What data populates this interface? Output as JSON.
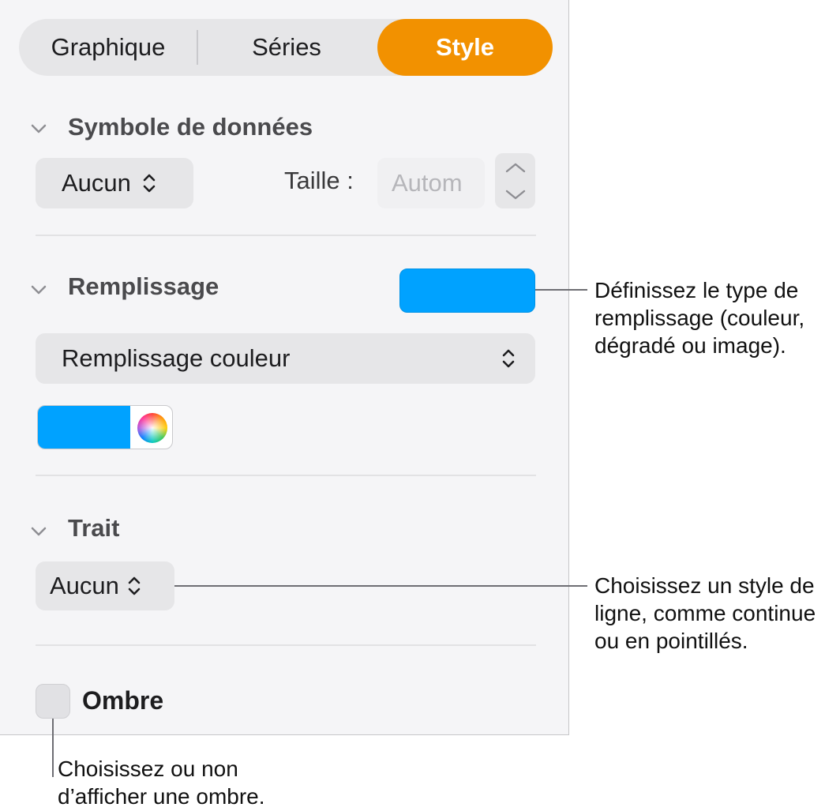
{
  "tabs": [
    "Graphique",
    "Séries",
    "Style"
  ],
  "active_tab": "Style",
  "accent_color": "#f29100",
  "data_symbol": {
    "title": "Symbole de données",
    "popup_value": "Aucun",
    "size_label": "Taille :",
    "size_placeholder": "Autom"
  },
  "fill": {
    "title": "Remplissage",
    "swatch_color": "#00a2ff",
    "type_value": "Remplissage couleur",
    "color": "#00a2ff"
  },
  "stroke": {
    "title": "Trait",
    "popup_value": "Aucun"
  },
  "shadow": {
    "label": "Ombre",
    "checked": false
  },
  "callouts": {
    "fill": [
      "Définissez le type de",
      "remplissage (couleur,",
      "dégradé ou image)."
    ],
    "stroke": [
      "Choisissez un style de",
      "ligne, comme continue",
      "ou en pointillés."
    ],
    "shadow": [
      "Choisissez ou non",
      "d’afficher une ombre."
    ]
  }
}
